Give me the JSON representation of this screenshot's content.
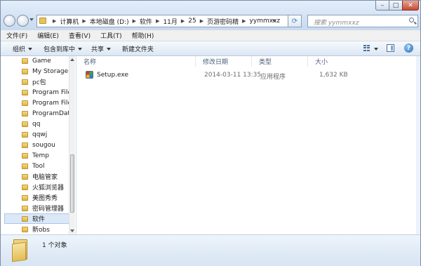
{
  "address": {
    "crumbs": [
      "计算机",
      "本地磁盘 (D:)",
      "软件",
      "11月",
      "25",
      "页游密码精",
      "yymmxxz"
    ]
  },
  "search": {
    "placeholder": "搜索 yymmxxz"
  },
  "menubar": {
    "items": [
      "文件(F)",
      "编辑(E)",
      "查看(V)",
      "工具(T)",
      "帮助(H)"
    ]
  },
  "toolbar": {
    "organize": "组织",
    "include_in_library": "包含到库中",
    "share": "共享",
    "new_folder": "新建文件夹"
  },
  "sidebar": {
    "items": [
      {
        "label": "Game"
      },
      {
        "label": "My Storage"
      },
      {
        "label": "pc包"
      },
      {
        "label": "Program Files"
      },
      {
        "label": "Program Files"
      },
      {
        "label": "ProgramData"
      },
      {
        "label": "qq"
      },
      {
        "label": "qqwj"
      },
      {
        "label": "sougou"
      },
      {
        "label": "Temp"
      },
      {
        "label": "Tool"
      },
      {
        "label": "电脑管家"
      },
      {
        "label": "火狐浏览器"
      },
      {
        "label": "美图秀秀"
      },
      {
        "label": "密码管理器"
      },
      {
        "label": "软件",
        "selected": true
      },
      {
        "label": "新obs"
      }
    ]
  },
  "columns": {
    "name": "名称",
    "modified": "修改日期",
    "type": "类型",
    "size": "大小"
  },
  "files": [
    {
      "name": "Setup.exe",
      "modified": "2014-03-11 13:35",
      "type": "应用程序",
      "size": "1,632 KB",
      "icon": "exe-icon"
    }
  ],
  "status": {
    "text": "1 个对象"
  }
}
